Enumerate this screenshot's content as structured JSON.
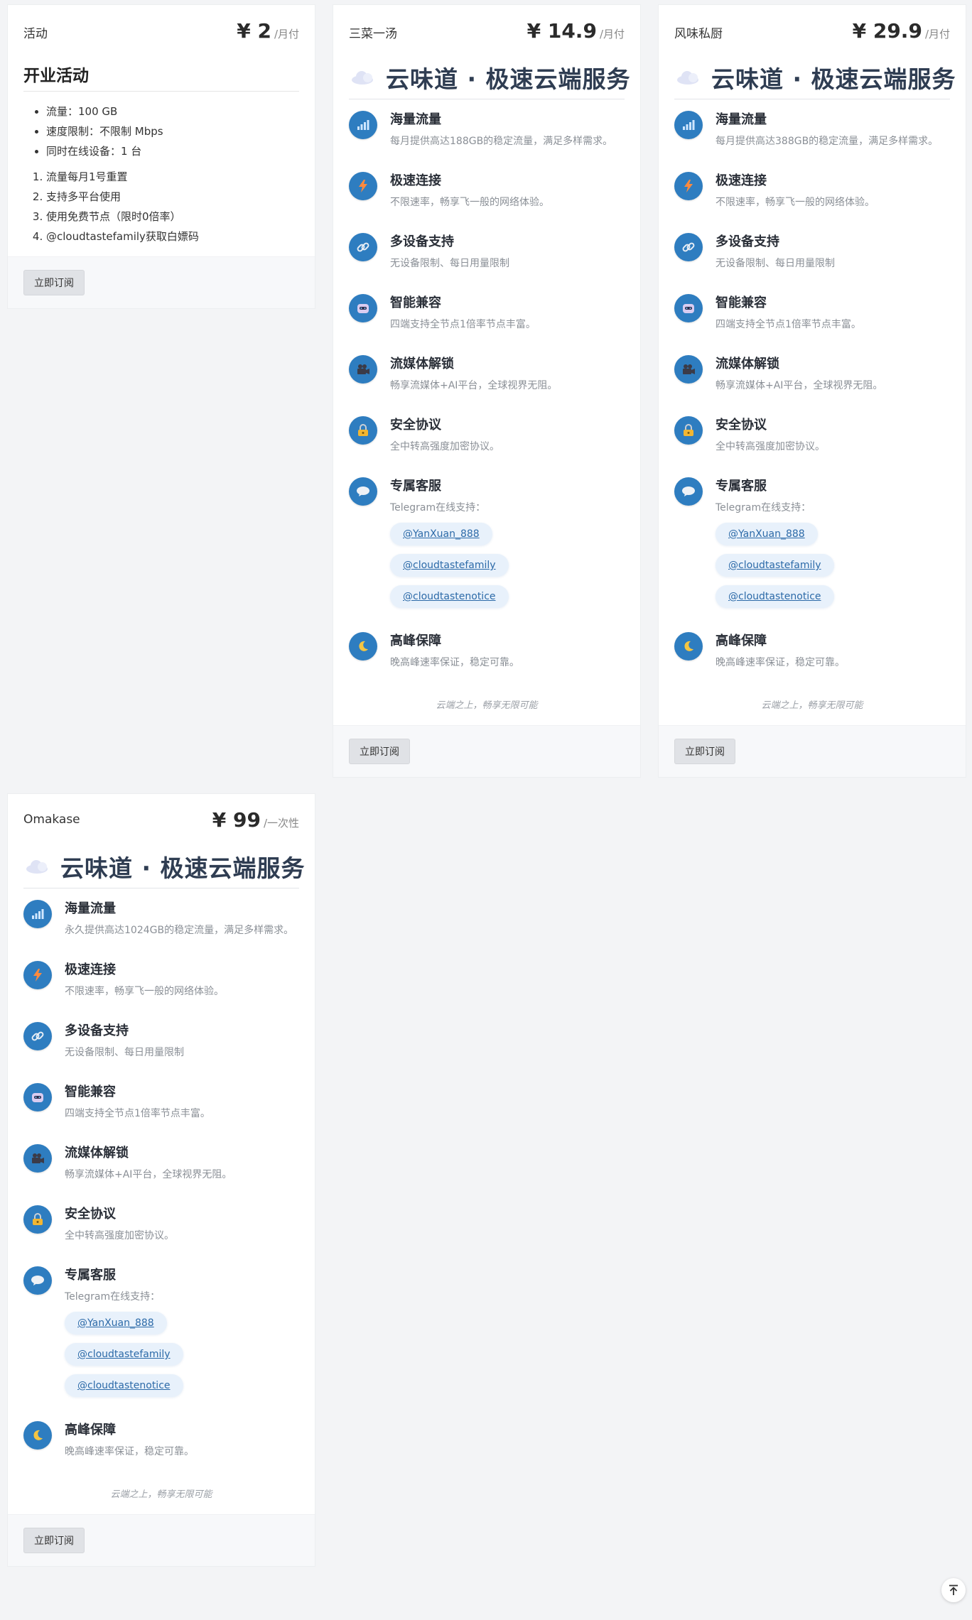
{
  "cards": {
    "activity": {
      "name": "活动",
      "price": "¥ 2",
      "period": "/月付",
      "title": "开业活动",
      "bullets": [
        "流量：100 GB",
        "速度限制：不限制 Mbps",
        "同时在线设备：1 台"
      ],
      "steps": [
        "流量每月1号重置",
        "支持多平台使用",
        "使用免费节点（限时0倍率）",
        "@cloudtastefamily获取白嫖码"
      ],
      "button": "立即订阅"
    },
    "sancai": {
      "name": "三菜一汤",
      "price": "¥ 14.9",
      "period": "/月付",
      "hero": "云味道 · 极速云端服务",
      "features": [
        {
          "title": "海量流量",
          "desc": "每月提供高达188GB的稳定流量，满足多样需求。"
        },
        {
          "title": "极速连接",
          "desc": "不限速率，畅享飞一般的网络体验。"
        },
        {
          "title": "多设备支持",
          "desc": "无设备限制、每日用量限制"
        },
        {
          "title": "智能兼容",
          "desc": "四端支持全节点1倍率节点丰富。"
        },
        {
          "title": "流媒体解锁",
          "desc": "畅享流媒体+AI平台，全球视界无阻。"
        },
        {
          "title": "安全协议",
          "desc": "全中转高强度加密协议。"
        },
        {
          "title": "专属客服",
          "desc": "Telegram在线支持："
        },
        {
          "title": "高峰保障",
          "desc": "晚高峰速率保证，稳定可靠。"
        }
      ],
      "tags": [
        "@YanXuan_888",
        "@cloudtastefamily",
        "@cloudtastenotice"
      ],
      "slogan": "云端之上，畅享无限可能",
      "button": "立即订阅"
    },
    "fengwei": {
      "name": "风味私厨",
      "price": "¥ 29.9",
      "period": "/月付",
      "hero": "云味道 · 极速云端服务",
      "features": [
        {
          "title": "海量流量",
          "desc": "每月提供高达388GB的稳定流量，满足多样需求。"
        },
        {
          "title": "极速连接",
          "desc": "不限速率，畅享飞一般的网络体验。"
        },
        {
          "title": "多设备支持",
          "desc": "无设备限制、每日用量限制"
        },
        {
          "title": "智能兼容",
          "desc": "四端支持全节点1倍率节点丰富。"
        },
        {
          "title": "流媒体解锁",
          "desc": "畅享流媒体+AI平台，全球视界无阻。"
        },
        {
          "title": "安全协议",
          "desc": "全中转高强度加密协议。"
        },
        {
          "title": "专属客服",
          "desc": "Telegram在线支持："
        },
        {
          "title": "高峰保障",
          "desc": "晚高峰速率保证，稳定可靠。"
        }
      ],
      "tags": [
        "@YanXuan_888",
        "@cloudtastefamily",
        "@cloudtastenotice"
      ],
      "slogan": "云端之上，畅享无限可能",
      "button": "立即订阅"
    },
    "omakase": {
      "name": "Omakase",
      "price": "¥ 99",
      "period": "/一次性",
      "hero": "云味道 · 极速云端服务",
      "features": [
        {
          "title": "海量流量",
          "desc": "永久提供高达1024GB的稳定流量，满足多样需求。"
        },
        {
          "title": "极速连接",
          "desc": "不限速率，畅享飞一般的网络体验。"
        },
        {
          "title": "多设备支持",
          "desc": "无设备限制、每日用量限制"
        },
        {
          "title": "智能兼容",
          "desc": "四端支持全节点1倍率节点丰富。"
        },
        {
          "title": "流媒体解锁",
          "desc": "畅享流媒体+AI平台，全球视界无阻。"
        },
        {
          "title": "安全协议",
          "desc": "全中转高强度加密协议。"
        },
        {
          "title": "专属客服",
          "desc": "Telegram在线支持："
        },
        {
          "title": "高峰保障",
          "desc": "晚高峰速率保证，稳定可靠。"
        }
      ],
      "tags": [
        "@YanXuan_888",
        "@cloudtastefamily",
        "@cloudtastenotice"
      ],
      "slogan": "云端之上，畅享无限可能",
      "button": "立即订阅"
    }
  },
  "feature_icons": [
    "bar-chart-icon",
    "lightning-icon",
    "link-icon",
    "robot-icon",
    "video-camera-icon",
    "lock-icon",
    "speech-bubble-icon",
    "moon-icon"
  ],
  "colors": {
    "icon_bg": "#2e7dc0",
    "tag_bg": "#e8f1fb",
    "tag_text": "#2c6aa8",
    "hero_text": "#2f3d52"
  }
}
